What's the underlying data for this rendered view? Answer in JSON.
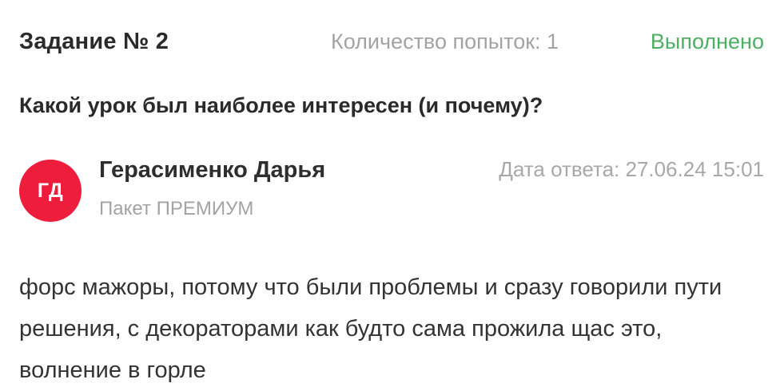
{
  "task": {
    "title": "Задание № 2",
    "attempts": "Количество попыток: 1",
    "status": "Выполнено",
    "status_color": "#4caf62"
  },
  "question": "Какой урок был наиболее интересен (и почему)?",
  "answer": {
    "avatar_initials": "ГД",
    "avatar_color": "#ee1d3c",
    "author_name": "Герасименко Дарья",
    "package": "Пакет ПРЕМИУМ",
    "date": "Дата ответа: 27.06.24 15:01",
    "text": "форс мажоры, потому что были проблемы и сразу говорили пути решения, с декораторами как будто сама прожила щас это, волнение в горле"
  }
}
